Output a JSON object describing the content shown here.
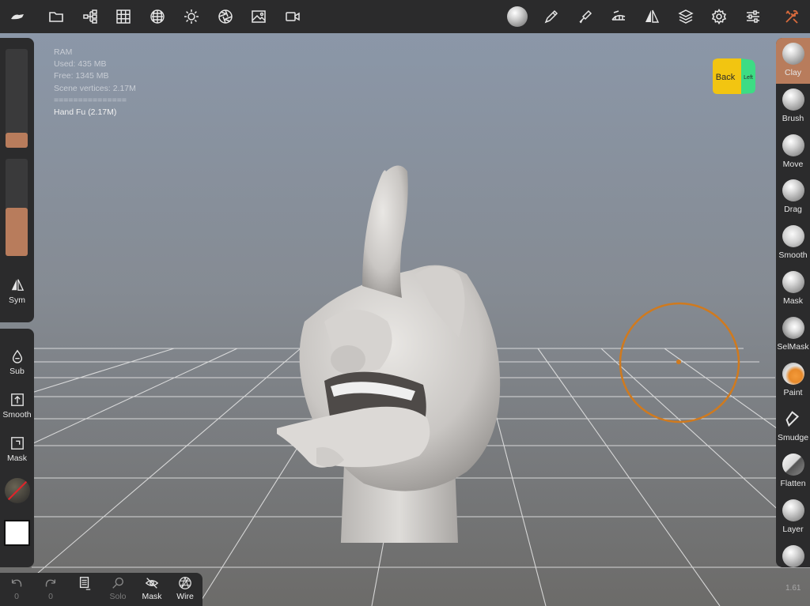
{
  "stats": {
    "title": "RAM",
    "used": "Used: 435 MB",
    "free": "Free: 1345 MB",
    "vertices": "Scene vertices: 2.17M",
    "separator": "===============",
    "mesh": "Hand Fu (2.17M)"
  },
  "topbar": {
    "left_icons": [
      "app-logo-icon",
      "folder-icon",
      "scene-tree-icon",
      "grid-icon",
      "shading-icon",
      "light-icon",
      "aperture-icon",
      "image-icon",
      "camera-icon"
    ],
    "right_icons": [
      "material-ball-icon",
      "pen-icon",
      "brush-tool-icon",
      "topology-icon",
      "symmetry-icon",
      "layers-icon",
      "settings-icon",
      "sliders-icon",
      "tools-icon"
    ]
  },
  "left": {
    "sym": "Sym",
    "sub": "Sub",
    "smooth": "Smooth",
    "mask": "Mask",
    "radius_slider": 0.15,
    "intensity_slider": 0.5
  },
  "bottombar": {
    "undo_count": "0",
    "redo_count": "0",
    "solo": "Solo",
    "mask": "Mask",
    "wire": "Wire"
  },
  "tools": [
    {
      "label": "Clay",
      "active": true
    },
    {
      "label": "Brush",
      "active": false
    },
    {
      "label": "Move",
      "active": false
    },
    {
      "label": "Drag",
      "active": false
    },
    {
      "label": "Smooth",
      "active": false
    },
    {
      "label": "Mask",
      "active": false
    },
    {
      "label": "SelMask",
      "active": false
    },
    {
      "label": "Paint",
      "active": false
    },
    {
      "label": "Smudge",
      "active": false
    },
    {
      "label": "Flatten",
      "active": false
    },
    {
      "label": "Layer",
      "active": false
    }
  ],
  "cube": {
    "front": "Back",
    "side": "Left"
  },
  "version": "1.61",
  "colors": {
    "accent": "#b87c5c",
    "panel": "#2b2b2c",
    "brush_ring": "#d07a1e",
    "cube_front": "#f2c511",
    "cube_side": "#3ddc84"
  }
}
